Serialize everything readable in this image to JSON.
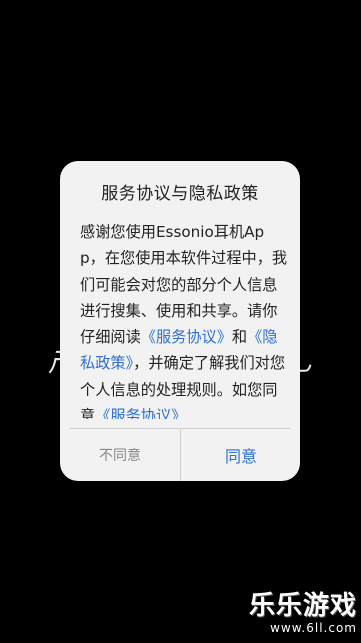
{
  "background": {
    "left_text": "产",
    "right_text": "乚"
  },
  "dialog": {
    "title": "服务协议与隐私政策",
    "body": {
      "intro": "感谢您使用Essonio耳机App，在您使用本软件过程中，我们可能会对您的部分个人信息进行搜集、使用和共享。请你仔细阅读",
      "link1": "《服务协议》",
      "middle": "和",
      "link2": "《隐私政策》",
      "after": "，并确定了解我们对您个人信息的处理规则。如您同意",
      "link3": "《服务协议》"
    },
    "disagree_label": "不同意",
    "agree_label": "同意"
  },
  "watermark": {
    "title": "乐乐游戏",
    "url": "www.6ll.com"
  },
  "colors": {
    "background": "#000000",
    "dialog_bg": "#f2f2f2",
    "link": "#2f6fd6",
    "disagree_text": "#888888"
  }
}
